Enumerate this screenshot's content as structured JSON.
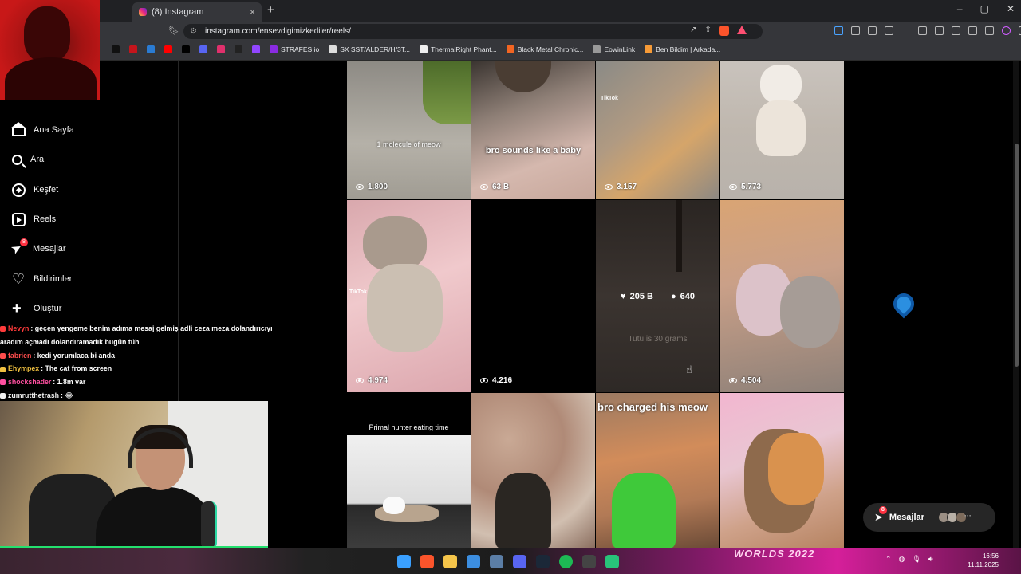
{
  "browser": {
    "tab_title": "(8) Instagram",
    "tab_close": "×",
    "new_tab": "+",
    "url": "instagram.com/ensevdigimizkediler/reels/",
    "window_controls": [
      "–",
      "▢",
      "✕"
    ],
    "bookmarks": [
      {
        "label": "",
        "color": "#111111"
      },
      {
        "label": "",
        "color": "#c4151c"
      },
      {
        "label": "",
        "color": "#2a7bd2"
      },
      {
        "label": "",
        "color": "#ff0000"
      },
      {
        "label": "",
        "color": "#000000"
      },
      {
        "label": "",
        "color": "#5865f2"
      },
      {
        "label": "",
        "color": "#e1306c"
      },
      {
        "label": "",
        "color": "#222222"
      },
      {
        "label": "",
        "color": "#9146ff"
      },
      {
        "label": "STRAFES.io",
        "color": "#8a2be2"
      },
      {
        "label": "SX SST/ALDER/H/3T...",
        "color": "#dddddd"
      },
      {
        "label": "ThermalRight Phant...",
        "color": "#eeeeee"
      },
      {
        "label": "Black Metal Chronic...",
        "color": "#f26522"
      },
      {
        "label": "EowinLink",
        "color": "#999999"
      },
      {
        "label": "Ben Bildim | Arkada...",
        "color": "#f79b37"
      }
    ]
  },
  "sidebar": {
    "items": [
      {
        "label": "Ana Sayfa",
        "icon": "home-icon"
      },
      {
        "label": "Ara",
        "icon": "search-icon"
      },
      {
        "label": "Keşfet",
        "icon": "explore-icon"
      },
      {
        "label": "Reels",
        "icon": "reels-icon"
      },
      {
        "label": "Mesajlar",
        "icon": "messages-icon",
        "badge": "8"
      },
      {
        "label": "Bildirimler",
        "icon": "heart-icon"
      },
      {
        "label": "Oluştur",
        "icon": "plus-icon"
      }
    ]
  },
  "chat": [
    {
      "user": "Nevyn",
      "text": ": geçen yengeme benim adıma mesaj gelmiş adli ceza meza dolandırıcıyı",
      "color": "#ff3b3b"
    },
    {
      "user": "",
      "text": "aradım açmadı dolandıramadık bugün tüh",
      "color": "#ffffff"
    },
    {
      "user": "fabrien",
      "text": ": kedi yorumlaca bi anda",
      "color": "#ff4d4d"
    },
    {
      "user": "Ehympex",
      "text": ": The cat from screen",
      "color": "#f0c040"
    },
    {
      "user": "shockshader",
      "text": ": 1.8m var",
      "color": "#ff4fa0"
    },
    {
      "user": "zumrutthetrash",
      "text": ": 😂",
      "color": "#f0f0f0"
    }
  ],
  "reels": [
    {
      "caption": "1 molecule of meow",
      "views": "1.800"
    },
    {
      "caption": "bro sounds like a baby",
      "views": "63 B"
    },
    {
      "caption": "",
      "views": "3.157",
      "tiktok": "TikTok"
    },
    {
      "caption": "",
      "views": "5.773"
    },
    {
      "caption": "",
      "views": "4.974",
      "tiktok": "TikTok"
    },
    {
      "caption": "",
      "views": "4.216"
    },
    {
      "caption": "Tutu is 30 grams",
      "likes": "205 B",
      "comments": "640"
    },
    {
      "caption": "",
      "views": "4.504"
    },
    {
      "caption": "Primal hunter eating time",
      "views": ""
    },
    {
      "caption": "",
      "views": ""
    },
    {
      "caption": "bro charged his meow",
      "views": ""
    },
    {
      "caption": "",
      "views": ""
    }
  ],
  "message_bar": {
    "label": "Mesajlar",
    "badge": "8"
  },
  "taskbar": {
    "banner": "WORLDS 2022",
    "time": "16:56",
    "date": "11.11.2025"
  }
}
